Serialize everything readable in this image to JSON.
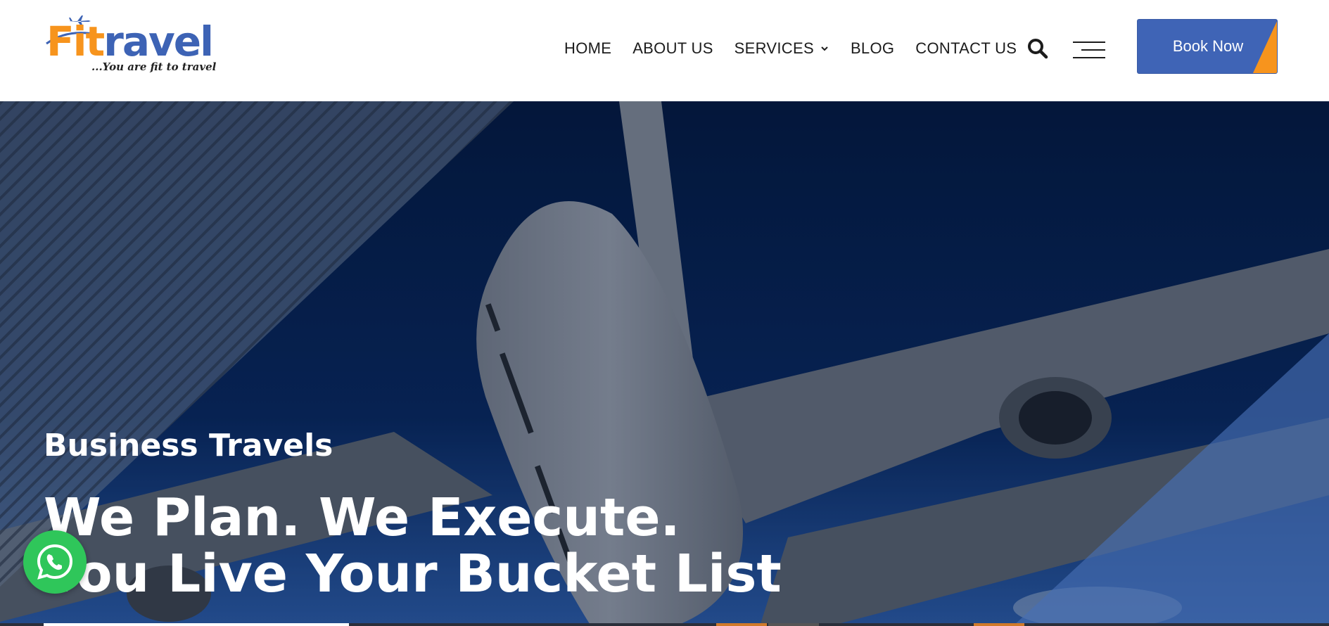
{
  "brand": {
    "name_part1": "Fit",
    "name_part2": "ravel",
    "tagline": "...You are fit to travel",
    "colors": {
      "orange": "#f7941d",
      "blue": "#3d63b5"
    }
  },
  "nav": {
    "items": [
      {
        "label": "HOME"
      },
      {
        "label": "ABOUT US"
      },
      {
        "label": "SERVICES",
        "has_dropdown": true
      },
      {
        "label": "BLOG"
      },
      {
        "label": "CONTACT US"
      }
    ],
    "search_icon": "search-icon",
    "menu_icon": "hamburger-icon"
  },
  "cta": {
    "label": "Book Now",
    "color": "#3f64b6",
    "accent": "#f7941d"
  },
  "hero": {
    "subtitle": "Business Travels",
    "title_line1": "We Plan. We Execute.",
    "title_line2": "You Live Your Bucket List"
  },
  "floating": {
    "whatsapp_icon": "whatsapp-icon",
    "color": "#2fc65a"
  }
}
